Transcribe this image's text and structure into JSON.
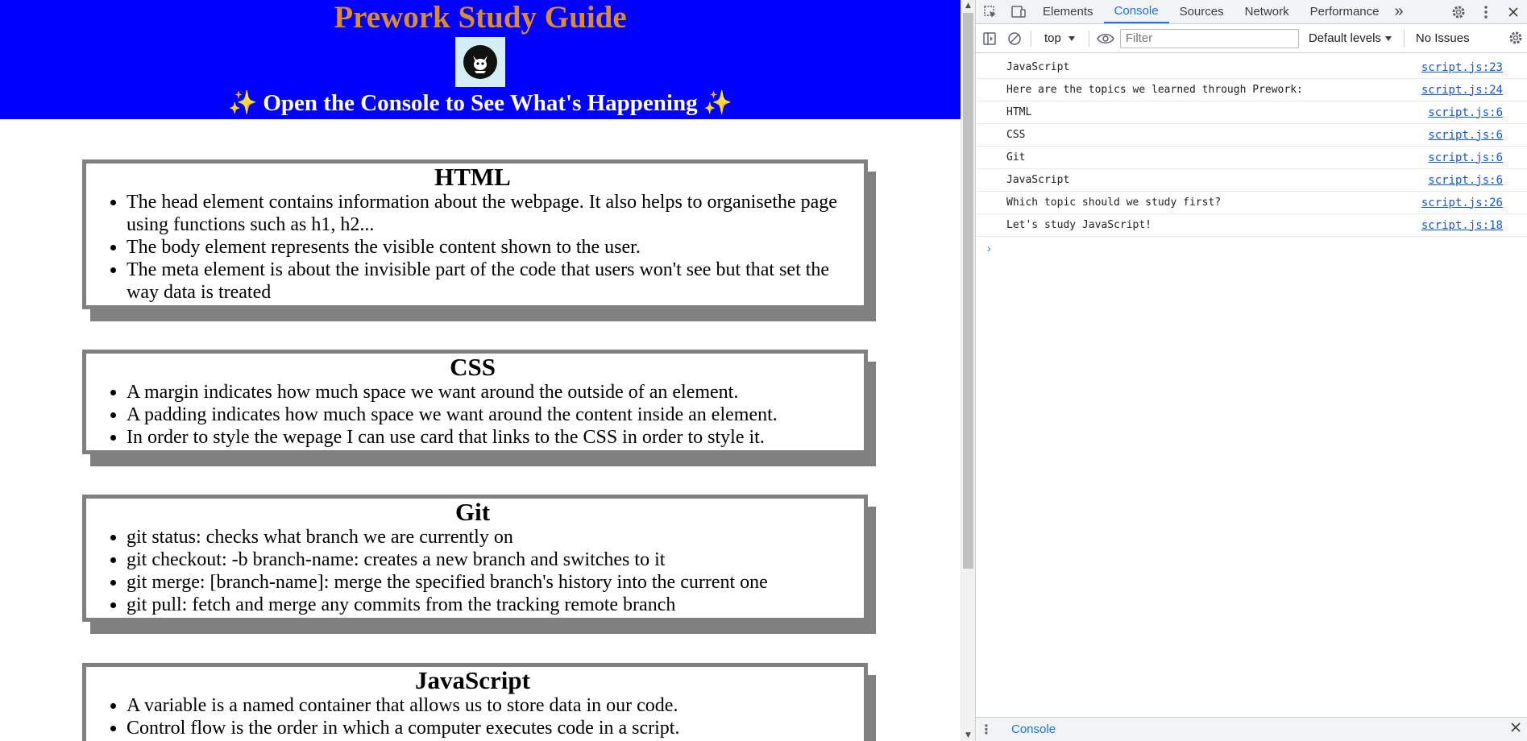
{
  "page": {
    "title": "Prework Study Guide",
    "subtitle": "✨ Open the Console to See What's Happening ✨",
    "cards": [
      {
        "heading": "HTML",
        "items": [
          "The head element contains information about the webpage. It also helps to organisethe page using functions such as h1, h2...",
          "The body element represents the visible content shown to the user.",
          "The meta element is about the invisible part of the code that users won't see but that set the way data is treated"
        ]
      },
      {
        "heading": "CSS",
        "items": [
          "A margin indicates how much space we want around the outside of an element.",
          "A padding indicates how much space we want around the content inside an element.",
          "In order to style the wepage I can use card that links to the CSS in order to style it."
        ]
      },
      {
        "heading": "Git",
        "items": [
          "git status: checks what branch we are currently on",
          "git checkout: -b branch-name: creates a new branch and switches to it",
          "git merge: [branch-name]: merge the specified branch's history into the current one",
          "git pull: fetch and merge any commits from the tracking remote branch"
        ]
      },
      {
        "heading": "JavaScript",
        "items": [
          "A variable is a named container that allows us to store data in our code.",
          "Control flow is the order in which a computer executes code in a script."
        ]
      }
    ]
  },
  "devtools": {
    "tabs": [
      "Elements",
      "Console",
      "Sources",
      "Network",
      "Performance"
    ],
    "active_tab": "Console",
    "more_tabs_glyph": "»",
    "context": "top",
    "filter_placeholder": "Filter",
    "levels": "Default levels",
    "issues": "No Issues",
    "logs": [
      {
        "message": "JavaScript",
        "source": "script.js:23"
      },
      {
        "message": "Here are the topics we learned through Prework:",
        "source": "script.js:24"
      },
      {
        "message": "HTML",
        "source": "script.js:6"
      },
      {
        "message": "CSS",
        "source": "script.js:6"
      },
      {
        "message": "Git",
        "source": "script.js:6"
      },
      {
        "message": "JavaScript",
        "source": "script.js:6"
      },
      {
        "message": "Which topic should we study first?",
        "source": "script.js:26"
      },
      {
        "message": "Let's study JavaScript!",
        "source": "script.js:18"
      }
    ],
    "prompt_glyph": "›",
    "drawer_tab": "Console"
  },
  "colors": {
    "hero_bg": "#0000fe",
    "title": "#d98c29",
    "accent": "#1a73e8",
    "card_border": "#808080"
  }
}
